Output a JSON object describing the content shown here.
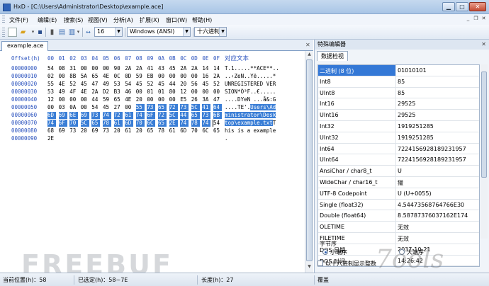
{
  "window": {
    "app": "HxD",
    "title": "HxD - [C:\\Users\\Administrator\\Desktop\\example.ace]"
  },
  "menu": {
    "items": [
      "文件(F)",
      "编辑(E)",
      "搜索(S)",
      "视图(V)",
      "分析(A)",
      "扩展(X)",
      "窗口(W)",
      "帮助(H)"
    ]
  },
  "toolbar": {
    "bytes_per_row": "16",
    "charset": "Windows (ANSI)",
    "offset_base": "十六进制"
  },
  "tab": {
    "label": "example.ace"
  },
  "editor": {
    "offset_header": "Offset(h)",
    "columns": [
      "00",
      "01",
      "02",
      "03",
      "04",
      "05",
      "06",
      "07",
      "08",
      "09",
      "0A",
      "0B",
      "0C",
      "0D",
      "0E",
      "0F"
    ],
    "text_header": "对应文本",
    "rows": [
      {
        "offset": "00000000",
        "hex": [
          "54",
          "08",
          "31",
          "00",
          "00",
          "00",
          "90",
          "2A",
          "2A",
          "41",
          "43",
          "45",
          "2A",
          "2A",
          "14",
          "14"
        ],
        "text": "T.1.....**ACE**.."
      },
      {
        "offset": "00000010",
        "hex": [
          "02",
          "00",
          "8B",
          "5A",
          "65",
          "4E",
          "0C",
          "0D",
          "59",
          "EB",
          "00",
          "00",
          "00",
          "00",
          "16",
          "2A"
        ],
        "text": "..‹ZeN..Yë.....*"
      },
      {
        "offset": "00000020",
        "hex": [
          "55",
          "4E",
          "52",
          "45",
          "47",
          "49",
          "53",
          "54",
          "45",
          "52",
          "45",
          "44",
          "20",
          "56",
          "45",
          "52"
        ],
        "text": "UNREGISTERED VER"
      },
      {
        "offset": "00000030",
        "hex": [
          "53",
          "49",
          "4F",
          "4E",
          "2A",
          "D2",
          "B3",
          "46",
          "00",
          "01",
          "01",
          "80",
          "12",
          "00",
          "00",
          "00"
        ],
        "text": "SION*Ò³F..€....."
      },
      {
        "offset": "00000040",
        "hex": [
          "12",
          "00",
          "00",
          "00",
          "44",
          "59",
          "65",
          "4E",
          "20",
          "00",
          "00",
          "00",
          "E5",
          "26",
          "3A",
          "47"
        ],
        "text": "....DYeN ...å&:G"
      },
      {
        "offset": "00000050",
        "hex": [
          "00",
          "03",
          "0A",
          "00",
          "54",
          "45",
          "27",
          "00",
          "55",
          "73",
          "65",
          "72",
          "73",
          "5C",
          "41",
          "64"
        ],
        "text": "....TE'.Users\\Ad",
        "sel_from": 8
      },
      {
        "offset": "00000060",
        "hex": [
          "6D",
          "69",
          "6E",
          "69",
          "73",
          "74",
          "72",
          "61",
          "74",
          "6F",
          "72",
          "5C",
          "44",
          "65",
          "73",
          "6B"
        ],
        "text": "ministrator\\Desk",
        "sel_from": 0
      },
      {
        "offset": "00000070",
        "hex": [
          "74",
          "6F",
          "70",
          "5C",
          "65",
          "78",
          "61",
          "6D",
          "70",
          "6C",
          "65",
          "2E",
          "74",
          "78",
          "74",
          "54"
        ],
        "text": "top\\example.txtT",
        "sel_from": 0,
        "sel_to": 15
      },
      {
        "offset": "00000080",
        "hex": [
          "68",
          "69",
          "73",
          "20",
          "69",
          "73",
          "20",
          "61",
          "20",
          "65",
          "78",
          "61",
          "6D",
          "70",
          "6C",
          "65"
        ],
        "text": "his is a example"
      },
      {
        "offset": "00000090",
        "hex": [
          "2E"
        ],
        "text": "."
      }
    ]
  },
  "inspector": {
    "title": "特殊编辑器",
    "tab": "数据检视",
    "rows": [
      {
        "key": "二进制 (8 位)",
        "value": "01010101",
        "active": true
      },
      {
        "key": "Int8",
        "value": "85"
      },
      {
        "key": "UInt8",
        "value": "85"
      },
      {
        "key": "Int16",
        "value": "29525"
      },
      {
        "key": "UInt16",
        "value": "29525"
      },
      {
        "key": "Int32",
        "value": "1919251285"
      },
      {
        "key": "UInt32",
        "value": "1919251285"
      },
      {
        "key": "Int64",
        "value": "7224156928189231957"
      },
      {
        "key": "UInt64",
        "value": "7224156928189231957"
      },
      {
        "key": "AnsiChar / char8_t",
        "value": "U"
      },
      {
        "key": "WideChar / char16_t",
        "value": "獵"
      },
      {
        "key": "UTF-8 Codepoint",
        "value": "U (U+0055)"
      },
      {
        "key": "Single (float32)",
        "value": "4.54473568764766E30"
      },
      {
        "key": "Double (float64)",
        "value": "8.58787376037162E174"
      },
      {
        "key": "OLETIME",
        "value": "无效"
      },
      {
        "key": "FILETIME",
        "value": "无效"
      },
      {
        "key": "DOS 日期",
        "value": "2037-10-21"
      },
      {
        "key": "DOS 时间",
        "value": "14:26:42"
      }
    ],
    "byte_order_label": "字节序",
    "little_endian": "小端序",
    "big_endian": "大端序",
    "hex_checkbox": "以十六进制显示整数"
  },
  "status": {
    "position": "当前位置(h)：58",
    "selection": "已选定(h)：58~7E",
    "length": "长度(h)：27",
    "mode": "覆盖"
  },
  "watermarks": {
    "left": "FREEBUF",
    "right": "7ools"
  }
}
